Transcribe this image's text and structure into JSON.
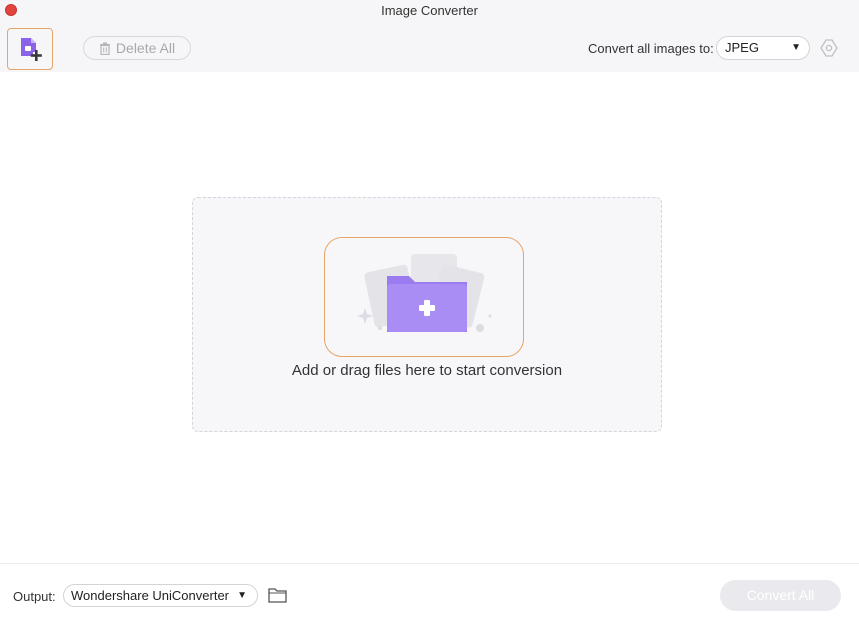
{
  "window": {
    "title": "Image Converter"
  },
  "toolbar": {
    "add_files_icon": "add-file-icon",
    "delete_all_label": "Delete All",
    "convert_label": "Convert all images to:",
    "format_value": "JPEG",
    "settings_icon": "settings-icon"
  },
  "dropzone": {
    "prompt": "Add or drag files here to start conversion",
    "icon": "folder-plus-icon",
    "accent_color": "#e8a567",
    "folder_color": "#9b7cf0"
  },
  "footer": {
    "output_label": "Output:",
    "output_value": "Wondershare UniConverter",
    "folder_icon": "folder-icon",
    "convert_all_label": "Convert All"
  }
}
